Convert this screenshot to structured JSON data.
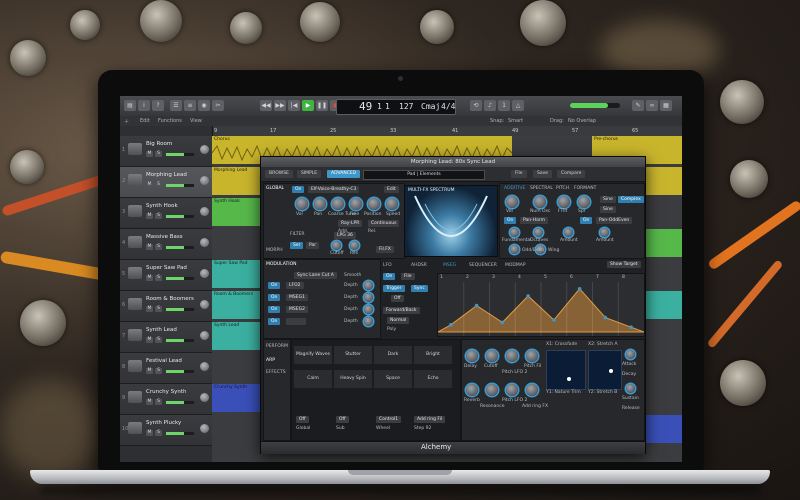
{
  "window": {
    "plugin_title": "Morphing Lead: 80s Sync Lead",
    "footer_title": "Alchemy"
  },
  "transport": {
    "bar": "49",
    "beat": "1",
    "sub": "1",
    "tempo": "127",
    "key": "Cmaj",
    "sig": "4/4"
  },
  "subbar": {
    "edit": "Edit",
    "functions": "Functions",
    "view": "View",
    "snap_label": "Snap:",
    "snap_value": "Smart",
    "drag_label": "Drag:",
    "drag_value": "No Overlap"
  },
  "ruler": [
    "9",
    "17",
    "25",
    "33",
    "41",
    "49",
    "57",
    "65"
  ],
  "tracks": [
    {
      "num": "1",
      "name": "Big Room",
      "selected": false
    },
    {
      "num": "2",
      "name": "Morphing Lead",
      "selected": true
    },
    {
      "num": "3",
      "name": "Synth Hook",
      "selected": false
    },
    {
      "num": "4",
      "name": "Massive Bass",
      "selected": false
    },
    {
      "num": "5",
      "name": "Super Saw Pad",
      "selected": false
    },
    {
      "num": "6",
      "name": "Room & Boomers",
      "selected": false
    },
    {
      "num": "7",
      "name": "Synth Lead",
      "selected": false
    },
    {
      "num": "8",
      "name": "Festival Lead",
      "selected": false
    },
    {
      "num": "9",
      "name": "Crunchy Synth",
      "selected": false
    },
    {
      "num": "10",
      "name": "Synth Plucky",
      "selected": false
    }
  ],
  "track_buttons": {
    "mute": "M",
    "solo": "S"
  },
  "regions": {
    "chorus": "Chorus",
    "prechorus": "Pre-chorus",
    "morphing": "Morphing Lead",
    "synth_hook": "Synth Hook",
    "super_saw": "Super Saw Pad",
    "room_boomers": "Room & Boomers",
    "synth_lead": "Synth Lead",
    "crunchy": "Crunchy Synth"
  },
  "colors": {
    "accent": "#3d97c9",
    "yellow": "#c9b52c",
    "green": "#57b84a",
    "teal": "#3bb0a0",
    "blue": "#3a4fb8"
  },
  "plugin": {
    "tabs": [
      "BROWSE",
      "SIMPLE",
      "ADVANCED"
    ],
    "active_tab": "ADVANCED",
    "preset": "Pad | Elements",
    "buttons": {
      "file": "File",
      "save": "Save",
      "compare": "Compare"
    },
    "global_label": "GLOBAL",
    "source_name": "Elf-Voice-Breathy-C3",
    "on": "On",
    "edit": "Edit",
    "source_knobs": [
      "Vol",
      "Pan",
      "Coarse Tune",
      "Fine",
      "Position",
      "Speed"
    ],
    "source_mode_1": "Ray-LPR",
    "source_mode_2": "Continuous",
    "source_extra_1": "Add.",
    "source_extra_2": "Rel.",
    "filter_label": "FILTER",
    "filter_type": "LPG 36",
    "filter_knobs": [
      "Cutoff",
      "Res"
    ],
    "filter_routing": "Ser",
    "filter_routing_2": "Par",
    "filter_route_value": "Fil.FX",
    "spectrum_label": "MULTI-FX SPECTRUM",
    "additive_tabs": [
      "ADDITIVE",
      "SPECTRAL",
      "PITCH",
      "FORMANT"
    ],
    "additive_knobs": [
      "Vol",
      "Num Osc",
      "FTilt",
      "Spr"
    ],
    "additive_knobs_2": [
      "Fundamental",
      "Octaves",
      "Amount",
      "Amount"
    ],
    "additive_knobs_3": [
      "Odd/Even",
      "Wing"
    ],
    "additive_wave_1": "Sine",
    "additive_wave_2": "Sine",
    "additive_mode": "Pan-Harm",
    "additive_mode_2": "Pan-OddEven",
    "additive_mode_3": "Complex",
    "additive_mode_4": "Sine",
    "morph_label": "MORPH",
    "modulation_label": "MODULATION",
    "mod_rows": [
      {
        "src": "LFO2",
        "dest": "Depth"
      },
      {
        "src": "MSEG1",
        "dest": "Depth"
      },
      {
        "src": "MSEG2",
        "dest": "Depth"
      },
      {
        "src": "",
        "dest": "Depth"
      }
    ],
    "mod_target": "Sync Lane Cut A",
    "mod_smooth": "Smooth",
    "mod_tabs": [
      "LFO",
      "AHDSR",
      "MSEG",
      "SEQUENCER",
      "MODMAP"
    ],
    "mod_active": "MSEG",
    "show_target": "Show Target",
    "mseg_ctrl_1": "Trigger",
    "mseg_ctrl_2": "Sync",
    "mseg_ctrl_3": "Off",
    "mseg_ctrl_4": "Forward/Back",
    "mseg_ctrl_5": "Normal",
    "mseg_ctrl_6": "Poly",
    "env_grid": [
      "1",
      "2",
      "3",
      "4",
      "5",
      "6",
      "7",
      "8"
    ],
    "env_points": [
      0.15,
      0.55,
      0.2,
      0.75,
      0.25,
      0.9,
      0.3,
      0.1
    ],
    "perform_label": "PERFORM",
    "arp_label": "ARP",
    "effects_label": "EFFECTS",
    "pads": [
      "Magnify Waves",
      "Stutter",
      "Dark",
      "Bright",
      "Calm",
      "Heavy Spin",
      "Space",
      "Echo"
    ],
    "pad_bottom": [
      "Off",
      "Off",
      "Control1",
      "Add ring Fil"
    ],
    "pad_bottom_labels": [
      "Global",
      "Sub",
      "Wheel",
      "Step 92"
    ],
    "knob_row_1": [
      "Delay",
      "Cutoff",
      "Pitch LFO 2",
      "Pitch Fil"
    ],
    "knob_row_2": [
      "Reverb",
      "Resonance",
      "Pitch LFO 2",
      "Add ring FX"
    ],
    "xy1": {
      "title": "X1: Crossfade",
      "label": "Y1: Nature Trim"
    },
    "xy2": {
      "title": "X2: Stretch A",
      "label": "Y2: Stretch B"
    },
    "right_knobs": [
      "Attack",
      "Decay",
      "Sustain",
      "Release"
    ]
  }
}
